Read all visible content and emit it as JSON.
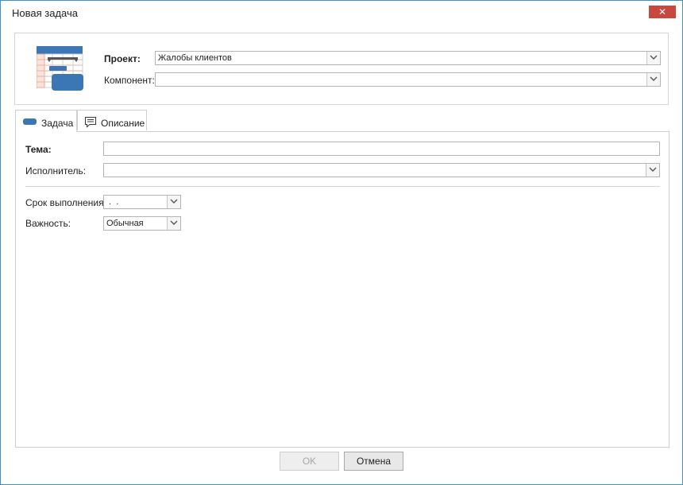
{
  "window": {
    "title": "Новая задача",
    "close_glyph": "✕"
  },
  "header": {
    "project": {
      "label": "Проект:",
      "value": "Жалобы клиентов"
    },
    "component": {
      "label": "Компонент:",
      "value": ""
    }
  },
  "tabs": [
    {
      "label": "Задача",
      "icon": "task-icon",
      "active": true
    },
    {
      "label": "Описание",
      "icon": "comment-icon",
      "active": false
    }
  ],
  "form": {
    "subject": {
      "label": "Тема:",
      "value": ""
    },
    "assignee": {
      "label": "Исполнитель:",
      "value": ""
    },
    "due_date": {
      "label": "Срок выполнения:",
      "value": " .  ."
    },
    "priority": {
      "label": "Важность:",
      "value": "Обычная"
    }
  },
  "footer": {
    "ok_label": "OK",
    "cancel_label": "Отмена"
  },
  "colors": {
    "accent": "#3c8fd5",
    "close": "#c9473d",
    "icon_blue": "#3b77b5"
  }
}
